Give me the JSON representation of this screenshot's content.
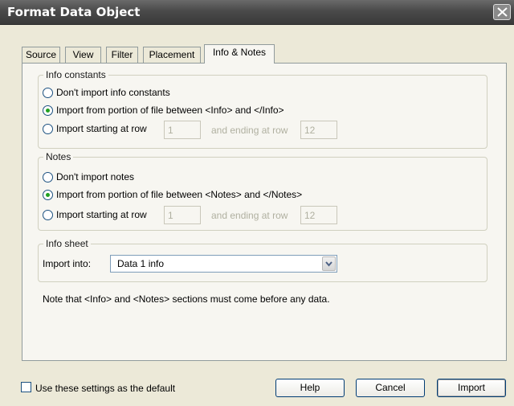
{
  "window": {
    "title": "Format Data Object"
  },
  "tabs": [
    {
      "label": "Source"
    },
    {
      "label": "View"
    },
    {
      "label": "Filter"
    },
    {
      "label": "Placement"
    },
    {
      "label": "Info & Notes",
      "active": true
    }
  ],
  "info_constants": {
    "legend": "Info constants",
    "options": [
      {
        "label": "Don't import info constants",
        "selected": false
      },
      {
        "label": "Import from portion of file between <Info> and </Info>",
        "selected": true
      },
      {
        "label": "Import starting at row",
        "selected": false
      }
    ],
    "start_row": "1",
    "ending_label": "and ending at row",
    "end_row": "12"
  },
  "notes": {
    "legend": "Notes",
    "options": [
      {
        "label": "Don't import notes",
        "selected": false
      },
      {
        "label": "Import from portion of file between <Notes> and </Notes>",
        "selected": true
      },
      {
        "label": "Import starting at row",
        "selected": false
      }
    ],
    "start_row": "1",
    "ending_label": "and ending at row",
    "end_row": "12"
  },
  "info_sheet": {
    "legend": "Info sheet",
    "import_into_label": "Import into:",
    "import_into_value": "Data 1 info"
  },
  "note_text": "Note that <Info> and <Notes> sections must come before any data.",
  "footer": {
    "default_checkbox_label": "Use these settings as the default",
    "default_checked": false,
    "help_label": "Help",
    "cancel_label": "Cancel",
    "import_label": "Import"
  },
  "colors": {
    "selected_radio": "#21a121",
    "button_border": "#003c74",
    "disabled_text": "#b0b0a0"
  }
}
